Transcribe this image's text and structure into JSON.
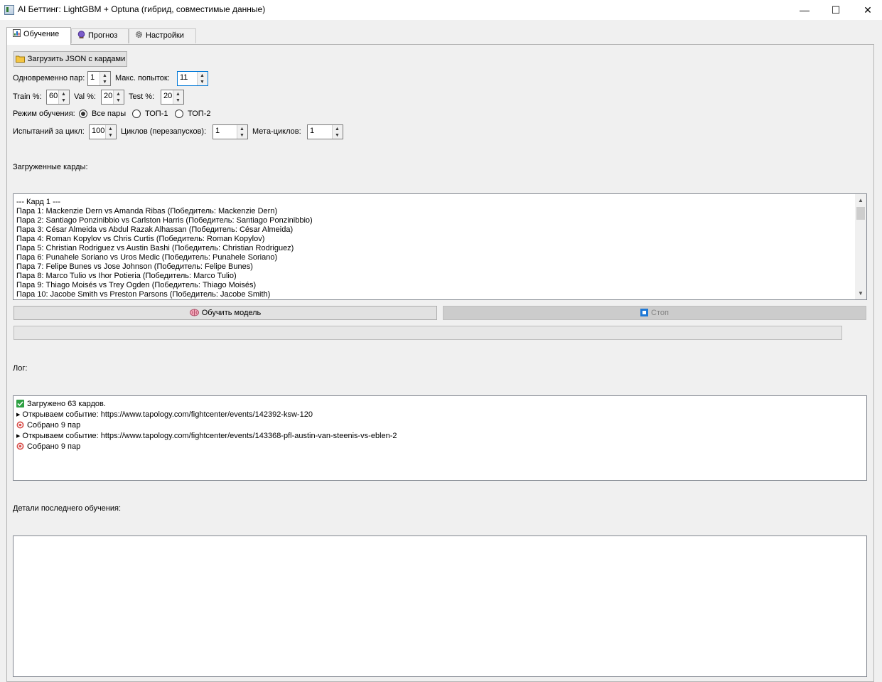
{
  "window": {
    "title": "AI Беттинг: LightGBM + Optuna (гибрид, совместимые данные)",
    "minimize_glyph": "—",
    "maximize_glyph": "☐",
    "close_glyph": "✕"
  },
  "tabs": [
    {
      "label": "Обучение",
      "icon": "bar-chart-icon",
      "active": true
    },
    {
      "label": "Прогноз",
      "icon": "crystal-ball-icon",
      "active": false
    },
    {
      "label": "Настройки",
      "icon": "gear-icon",
      "active": false
    }
  ],
  "training": {
    "load_json_button": "Загрузить JSON с кардами",
    "concurrent_pairs": {
      "label": "Одновременно пар:",
      "value": "1"
    },
    "max_attempts": {
      "label": "Макс. попыток:",
      "value": "11"
    },
    "train_pct": {
      "label": "Train %:",
      "value": "60"
    },
    "val_pct": {
      "label": "Val %:",
      "value": "20"
    },
    "test_pct": {
      "label": "Test %:",
      "value": "20"
    },
    "mode": {
      "label": "Режим обучения:",
      "options": [
        "Все пары",
        "ТОП-1",
        "ТОП-2"
      ],
      "selected": "Все пары"
    },
    "trials_per_cycle": {
      "label": "Испытаний за цикл:",
      "value": "100"
    },
    "cycles": {
      "label": "Циклов (перезапусков):",
      "value": "1"
    },
    "meta_cycles": {
      "label": "Мета-циклов:",
      "value": "1"
    },
    "loaded_cards_label": "Загруженные карды:",
    "cards_text": [
      "--- Кард 1 ---",
      " Пара 1: Mackenzie Dern vs Amanda Ribas (Победитель: Mackenzie Dern)",
      " Пара 2: Santiago Ponzinibbio vs Carlston Harris (Победитель: Santiago Ponzinibbio)",
      " Пара 3: César Almeida vs Abdul Razak Alhassan (Победитель: César Almeida)",
      " Пара 4: Roman Kopylov vs Chris Curtis (Победитель: Roman Kopylov)",
      " Пара 5: Christian Rodriguez vs Austin Bashi (Победитель: Christian Rodriguez)",
      " Пара 6: Punahele Soriano vs Uros Medic (Победитель: Punahele Soriano)",
      " Пара 7: Felipe Bunes vs Jose Johnson (Победитель: Felipe Bunes)",
      " Пара 8: Marco Tulio vs Ihor Potieria (Победитель: Marco Tulio)",
      " Пара 9: Thiago Moisés vs Trey Ogden (Победитель: Thiago Moisés)",
      " Пара 10: Jacobe Smith vs Preston Parsons (Победитель: Jacobe Smith)"
    ],
    "train_button": "Обучить модель",
    "stop_button": "Стоп",
    "progress": 0,
    "log_label": "Лог:",
    "log_lines": [
      {
        "icon": "check-icon",
        "text": "Загружено 63 кардов."
      },
      {
        "icon": "triangle-icon",
        "text": "Открываем событие: https://www.tapology.com/fightcenter/events/142392-ksw-120"
      },
      {
        "icon": "target-icon",
        "text": "Собрано 9 пар"
      },
      {
        "icon": "triangle-icon",
        "text": "Открываем событие: https://www.tapology.com/fightcenter/events/143368-pfl-austin-van-steenis-vs-eblen-2"
      },
      {
        "icon": "target-icon",
        "text": "Собрано 9 пар"
      }
    ],
    "details_label": "Детали последнего обучения:",
    "details_text": ""
  },
  "colors": {
    "focus_border": "#0078d7",
    "check_green": "#2ea043",
    "target_red": "#d9534f"
  }
}
